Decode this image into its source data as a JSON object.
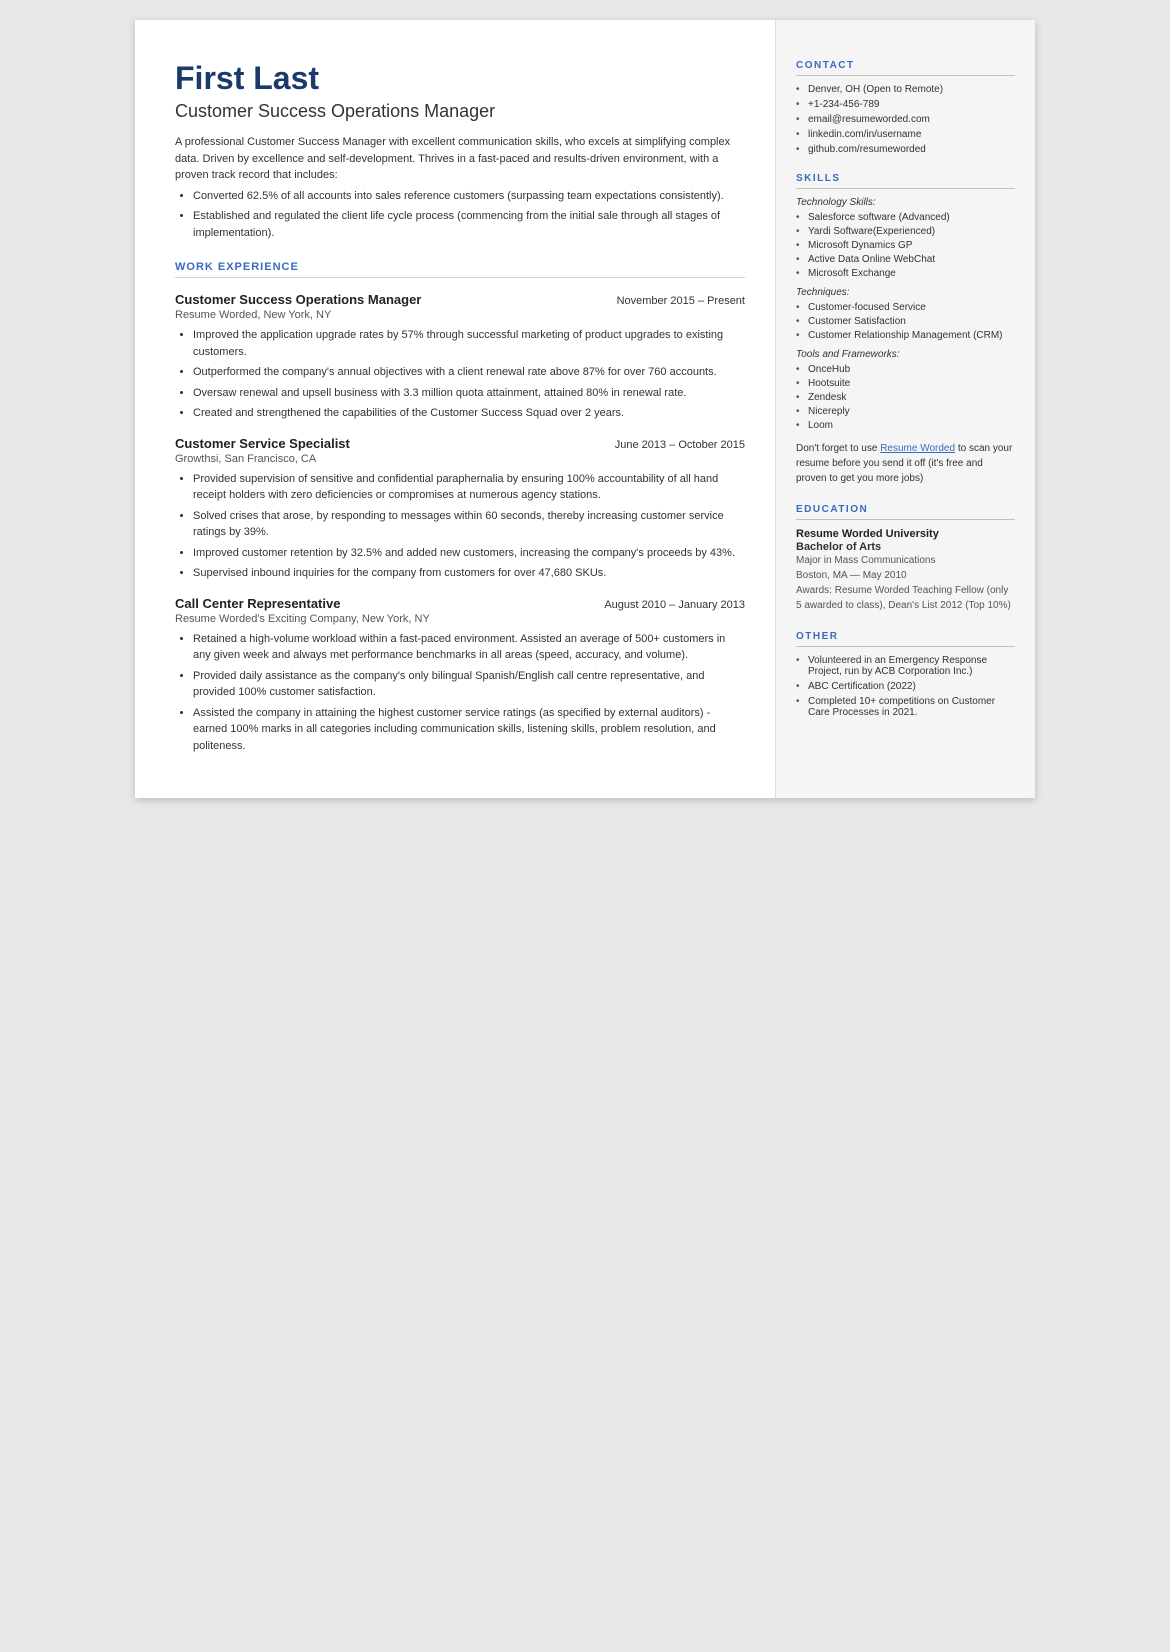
{
  "header": {
    "name": "First Last",
    "job_title": "Customer Success Operations Manager",
    "summary": "A professional Customer Success Manager with excellent communication skills, who excels at simplifying complex data. Driven by excellence and self-development. Thrives in a fast-paced and results-driven environment, with a proven track record that includes:",
    "bullets": [
      "Converted 62.5% of all accounts into sales reference customers (surpassing team expectations consistently).",
      "Established and regulated the client life cycle process (commencing from the initial sale through all stages of implementation)."
    ]
  },
  "sections": {
    "work_experience_label": "WORK EXPERIENCE",
    "skills_label": "SKILLS",
    "contact_label": "CONTACT",
    "education_label": "EDUCATION",
    "other_label": "OTHER"
  },
  "jobs": [
    {
      "title": "Customer Success Operations Manager",
      "dates": "November 2015 – Present",
      "company": "Resume Worded, New York, NY",
      "bullets": [
        "Improved the application upgrade rates by 57% through successful marketing of product upgrades to existing customers.",
        "Outperformed the company's annual objectives with a client renewal rate above 87% for over 760 accounts.",
        "Oversaw renewal and upsell business with 3.3 million quota attainment, attained 80% in renewal rate.",
        "Created and strengthened the capabilities of the Customer Success Squad over 2 years."
      ]
    },
    {
      "title": "Customer Service Specialist",
      "dates": "June 2013 – October 2015",
      "company": "Growthsi, San Francisco, CA",
      "bullets": [
        "Provided supervision of sensitive and confidential paraphernalia by ensuring 100% accountability of all hand receipt holders with zero deficiencies or compromises at numerous agency stations.",
        "Solved crises that arose, by responding to messages within 60 seconds, thereby increasing customer service ratings by 39%.",
        "Improved customer retention by 32.5% and added new customers, increasing the company's proceeds by 43%.",
        "Supervised inbound inquiries for the company from customers for over 47,680 SKUs."
      ]
    },
    {
      "title": "Call Center Representative",
      "dates": "August 2010 – January 2013",
      "company": "Resume Worded's Exciting Company, New York, NY",
      "bullets": [
        "Retained a high-volume workload within a fast-paced environment. Assisted an average of 500+ customers in any given week and always met performance benchmarks in all areas (speed, accuracy, and volume).",
        "Provided daily assistance as the company's only bilingual Spanish/English call centre representative, and provided 100% customer satisfaction.",
        "Assisted the company in attaining the highest customer service ratings (as specified by external auditors) - earned 100% marks in all categories including communication skills, listening skills, problem resolution, and politeness."
      ]
    }
  ],
  "contact": {
    "items": [
      "Denver, OH (Open to Remote)",
      "+1-234-456-789",
      "email@resumeworded.com",
      "linkedin.com/in/username",
      "github.com/resumeworded"
    ]
  },
  "skills": {
    "technology_label": "Technology Skills:",
    "technology_items": [
      "Salesforce software  (Advanced)",
      "Yardi Software(Experienced)",
      "Microsoft Dynamics GP",
      "Active Data Online WebChat",
      "Microsoft Exchange"
    ],
    "techniques_label": "Techniques:",
    "techniques_items": [
      "Customer-focused Service",
      "Customer Satisfaction",
      "Customer Relationship Management (CRM)"
    ],
    "tools_label": "Tools and Frameworks:",
    "tools_items": [
      "OnceHub",
      "Hootsuite",
      "Zendesk",
      "Nicereply",
      "Loom"
    ]
  },
  "promo": {
    "text_before": "Don't forget to use ",
    "link_text": "Resume Worded",
    "text_after": " to scan your resume before you send it off (it's free and proven to get you more jobs)"
  },
  "education": {
    "school": "Resume Worded University",
    "degree": "Bachelor of Arts",
    "major": "Major in Mass Communications",
    "location_date": "Boston, MA — May 2010",
    "awards": "Awards: Resume Worded Teaching Fellow (only 5 awarded to class), Dean's List 2012 (Top 10%)"
  },
  "other": {
    "items": [
      "Volunteered in an Emergency Response Project, run by ACB Corporation Inc.)",
      "ABC Certification (2022)",
      "Completed 10+ competitions on Customer Care  Processes in 2021."
    ]
  }
}
